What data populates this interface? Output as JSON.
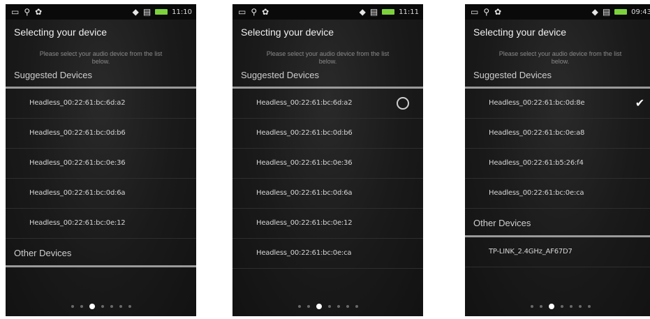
{
  "screens": [
    {
      "time": "11:10",
      "title": "Selecting your device",
      "description": "Please select your audio device from the list below.",
      "suggested_header": "Suggested Devices",
      "suggested": [
        "Headless_00:22:61:bc:6d:a2",
        "Headless_00:22:61:bc:0d:b6",
        "Headless_00:22:61:bc:0e:36",
        "Headless_00:22:61:bc:0d:6a",
        "Headless_00:22:61:bc:0e:12"
      ],
      "other_header": "Other Devices",
      "other": [],
      "page_index": 2,
      "page_count": 7
    },
    {
      "time": "11:11",
      "title": "Selecting your device",
      "description": "Please select your audio device from the list below.",
      "suggested_header": "Suggested Devices",
      "suggested": [
        "Headless_00:22:61:bc:6d:a2",
        "Headless_00:22:61:bc:0d:b6",
        "Headless_00:22:61:bc:0e:36",
        "Headless_00:22:61:bc:0d:6a",
        "Headless_00:22:61:bc:0e:12",
        "Headless_00:22:61:bc:0e:ca"
      ],
      "other_header": "",
      "other": [],
      "page_index": 2,
      "page_count": 7
    },
    {
      "time": "09:43",
      "title": "Selecting your device",
      "description": "Please select your audio device from the list below.",
      "suggested_header": "Suggested Devices",
      "suggested": [
        "Headless_00:22:61:bc:0d:8e",
        "Headless_00:22:61:bc:0e:a8",
        "Headless_00:22:61:b5:26:f4",
        "Headless_00:22:61:bc:0e:ca"
      ],
      "other_header": "Other Devices",
      "other": [
        "TP-LINK_2.4GHz_AF67D7"
      ],
      "page_index": 2,
      "page_count": 7
    }
  ],
  "icons": {
    "status_left": [
      "card-icon",
      "usb-icon",
      "debug-icon"
    ],
    "status_right": [
      "wifi-icon",
      "signal-icon",
      "battery-icon"
    ]
  },
  "colors": {
    "battery": "#7dd23c",
    "background": "#1b1b1b"
  }
}
